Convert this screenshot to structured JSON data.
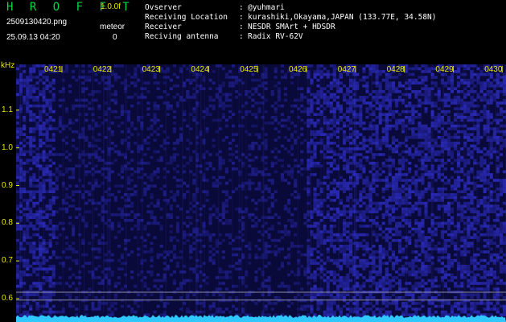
{
  "header": {
    "app_name": "H R O F F T",
    "version": "1.0.0f",
    "filename": "2509130420.png",
    "datetime": "25.09.13 04:20",
    "meteor_label": "meteor",
    "meteor_count": "0"
  },
  "info": [
    {
      "key": "Ovserver",
      "value": "@yuhmari"
    },
    {
      "key": "Receiving Location",
      "value": "kurashiki,Okayama,JAPAN (133.77E, 34.58N)"
    },
    {
      "key": "Receiver",
      "value": "NESDR SMArt + HDSDR"
    },
    {
      "key": "Reciving antenna",
      "value": "Radix RV-62V"
    }
  ],
  "colors": {
    "label": "#e8e800",
    "title": "#00d84a",
    "waterfall_base": "#0a0a3a",
    "waterfall_noise": "#3030d0",
    "spectrum": "#2ec8ff"
  },
  "chart_data": {
    "type": "heatmap",
    "ylabel": "kHz",
    "y_ticks": [
      "1.1",
      "1.0",
      "0.9",
      "0.8",
      "0.7",
      "0.6"
    ],
    "x_ticks": [
      "0421",
      "0422",
      "0423",
      "0424",
      "0425",
      "0426",
      "0427",
      "0428",
      "0429",
      "0430"
    ],
    "ylim": [
      0.57,
      1.2
    ]
  }
}
